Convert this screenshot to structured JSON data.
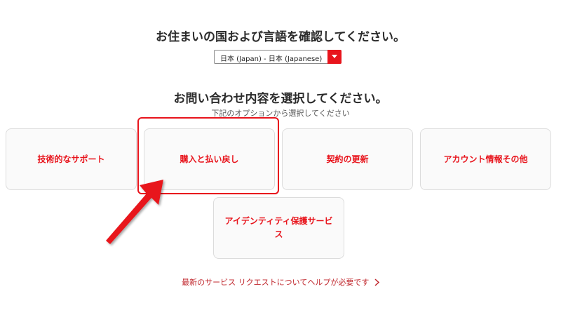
{
  "country": {
    "heading": "お住まいの国および言語を確認してください。",
    "selected": "日本 (Japan) - 日本 (Japanese)",
    "accent": "#e8141c"
  },
  "topics": {
    "heading": "お問い合わせ内容を選択してください。",
    "subtext": "下記のオプションから選択してください",
    "options": [
      {
        "label": "技術的なサポート"
      },
      {
        "label": "購入と払い戻し"
      },
      {
        "label": "契約の更新"
      },
      {
        "label": "アカウント情報その他"
      },
      {
        "label": "アイデンティティ保護サービス"
      }
    ]
  },
  "help_link": {
    "label": "最新のサービス リクエストについてヘルプが必要です"
  },
  "icons": {
    "dropdown": "caret-down-icon",
    "link": "chevron-right-icon",
    "annotation": "red-arrow-icon"
  }
}
